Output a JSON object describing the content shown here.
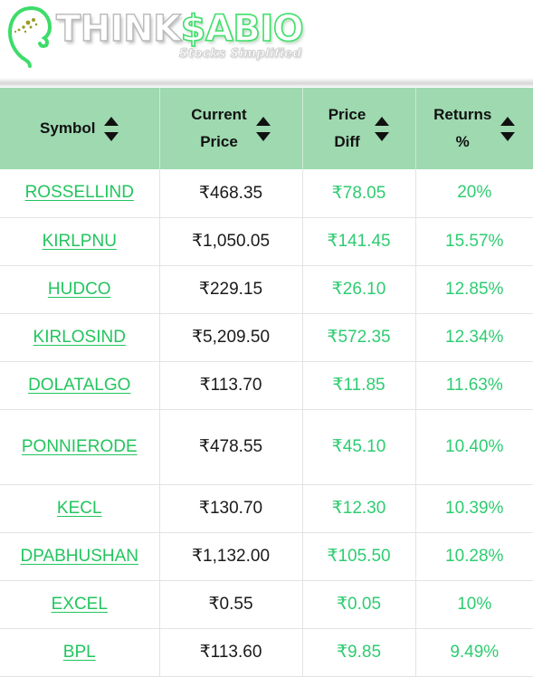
{
  "brand": {
    "logo_icon": "head-profile-icon",
    "word_part1": "THINK",
    "word_part2": "$ABIO",
    "tagline": "Stocks Simplified",
    "green": "#3fe06a",
    "gray": "#b9b9b9"
  },
  "table": {
    "header_bg": "#9ed9b0",
    "link_color": "#22c55e",
    "positive_color": "#2ecc71",
    "columns": [
      {
        "key": "symbol",
        "label_line1": "Symbol",
        "label_line2": "",
        "sortable": true
      },
      {
        "key": "price",
        "label_line1": "Current",
        "label_line2": "Price",
        "sortable": true
      },
      {
        "key": "diff",
        "label_line1": "Price",
        "label_line2": "Diff",
        "sortable": true
      },
      {
        "key": "returns",
        "label_line1": "Returns",
        "label_line2": "%",
        "sortable": true
      }
    ],
    "sort_up_icon": "sort-ascending-icon",
    "sort_down_icon": "sort-descending-icon",
    "rows": [
      {
        "symbol": "ROSSELLIND",
        "price": "₹468.35",
        "diff": "₹78.05",
        "returns": "20%"
      },
      {
        "symbol": "KIRLPNU",
        "price": "₹1,050.05",
        "diff": "₹141.45",
        "returns": "15.57%"
      },
      {
        "symbol": "HUDCO",
        "price": "₹229.15",
        "diff": "₹26.10",
        "returns": "12.85%"
      },
      {
        "symbol": "KIRLOSIND",
        "price": "₹5,209.50",
        "diff": "₹572.35",
        "returns": "12.34%"
      },
      {
        "symbol": "DOLATALGO",
        "price": "₹113.70",
        "diff": "₹11.85",
        "returns": "11.63%"
      },
      {
        "symbol": "PONNIERODE",
        "price": "₹478.55",
        "diff": "₹45.10",
        "returns": "10.40%",
        "tall": true
      },
      {
        "symbol": "KECL",
        "price": "₹130.70",
        "diff": "₹12.30",
        "returns": "10.39%"
      },
      {
        "symbol": "DPABHUSHAN",
        "price": "₹1,132.00",
        "diff": "₹105.50",
        "returns": "10.28%"
      },
      {
        "symbol": "EXCEL",
        "price": "₹0.55",
        "diff": "₹0.05",
        "returns": "10%"
      },
      {
        "symbol": "BPL",
        "price": "₹113.60",
        "diff": "₹9.85",
        "returns": "9.49%"
      }
    ]
  }
}
